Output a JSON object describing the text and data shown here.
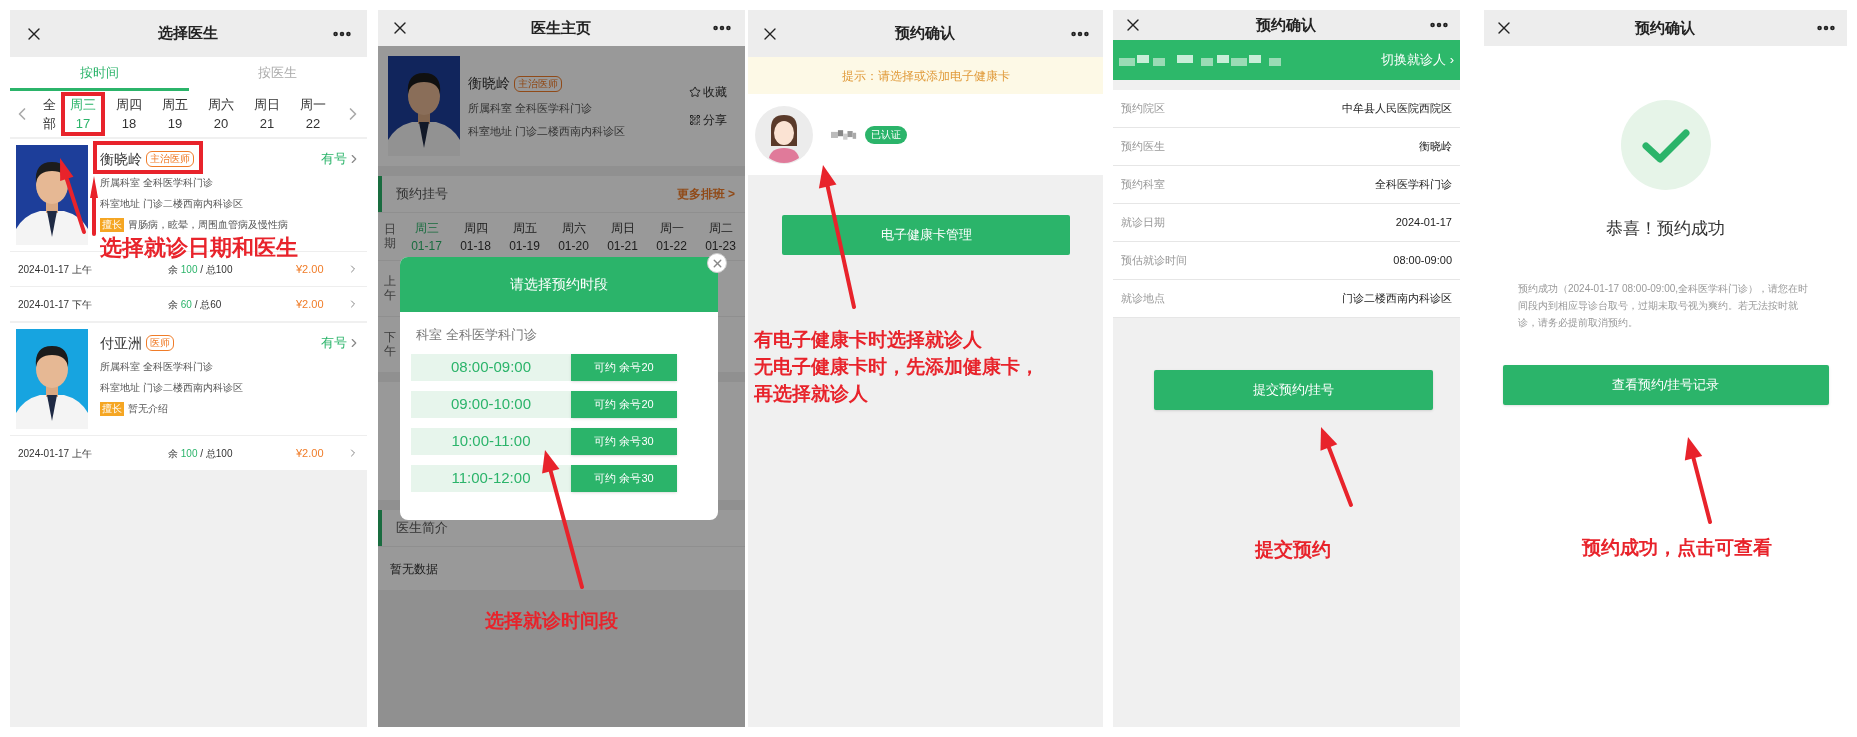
{
  "doctor_list_screen": {
    "title": "选择医生",
    "tabs": [
      {
        "label": "按时间",
        "selected": true
      },
      {
        "label": "按医生",
        "selected": false
      }
    ],
    "days": [
      {
        "weekday": "全",
        "date": "部",
        "selected": false
      },
      {
        "weekday": "周三",
        "date": "17",
        "selected": true
      },
      {
        "weekday": "周四",
        "date": "18",
        "selected": false
      },
      {
        "weekday": "周五",
        "date": "19",
        "selected": false
      },
      {
        "weekday": "周六",
        "date": "20",
        "selected": false
      },
      {
        "weekday": "周日",
        "date": "21",
        "selected": false
      },
      {
        "weekday": "周一",
        "date": "22",
        "selected": false
      }
    ],
    "doctors": [
      {
        "name": "衡晓岭",
        "title": "主治医师",
        "department_label": "所属科室",
        "department": "全科医学科门诊",
        "address_label": "科室地址",
        "address": "门诊二楼西南内科诊区",
        "specialty_label": "擅长",
        "specialty": "胃肠病，眩晕，周围血管病及慢性病",
        "availability": "有号",
        "schedules": [
          {
            "date": "2024-01-17",
            "period": "上午",
            "remain_label": "余",
            "remain": "100",
            "total": "/ 总100",
            "price": "¥2.00"
          },
          {
            "date": "2024-01-17",
            "period": "下午",
            "remain_label": "余",
            "remain": "60",
            "total": "/ 总60",
            "price": "¥2.00"
          }
        ]
      },
      {
        "name": "付亚洲",
        "title": "医师",
        "department_label": "所属科室",
        "department": "全科医学科门诊",
        "address_label": "科室地址",
        "address": "门诊二楼西南内科诊区",
        "specialty_label": "擅长",
        "specialty": "暂无介绍",
        "availability": "有号",
        "schedules": [
          {
            "date": "2024-01-17",
            "period": "上午",
            "remain_label": "余",
            "remain": "100",
            "total": "/ 总100",
            "price": "¥2.00"
          }
        ]
      }
    ],
    "annotation": "选择就诊日期和医生"
  },
  "doctor_home_screen": {
    "title": "医生主页",
    "doctor": {
      "name": "衡晓岭",
      "title": "主治医师",
      "department_label": "所属科室",
      "department": "全科医学科门诊",
      "address_label": "科室地址",
      "address": "门诊二楼西南内科诊区"
    },
    "actions": [
      "收藏",
      "分享"
    ],
    "section_title": "预约挂号",
    "more_link": "更多排班 >",
    "date_label": "日期",
    "dates": [
      {
        "weekday": "周三",
        "date": "01-17",
        "selected": true
      },
      {
        "weekday": "周四",
        "date": "01-18",
        "selected": false
      },
      {
        "weekday": "周五",
        "date": "01-19",
        "selected": false
      },
      {
        "weekday": "周六",
        "date": "01-20",
        "selected": false
      },
      {
        "weekday": "周日",
        "date": "01-21",
        "selected": false
      },
      {
        "weekday": "周一",
        "date": "01-22",
        "selected": false
      },
      {
        "weekday": "周二",
        "date": "01-23",
        "selected": false
      }
    ],
    "periods": [
      "上午",
      "下午"
    ],
    "intro_title": "医生简介",
    "intro_text": "暂无数据",
    "modal": {
      "title": "请选择预约时段",
      "department_label": "科室",
      "department": "全科医学科门诊",
      "slots": [
        {
          "time": "08:00-09:00",
          "button": "可约 余号20"
        },
        {
          "time": "09:00-10:00",
          "button": "可约 余号20"
        },
        {
          "time": "10:00-11:00",
          "button": "可约 余号30"
        },
        {
          "time": "11:00-12:00",
          "button": "可约 余号30"
        }
      ]
    },
    "annotation": "选择就诊时间段"
  },
  "patient_screen": {
    "title": "预约确认",
    "tip": "提示：请选择或添加电子健康卡",
    "verified_badge": "已认证",
    "button": "电子健康卡管理",
    "annotation_lines": [
      "有电子健康卡时选择就诊人",
      "无电子健康卡时，先添加健康卡，",
      "再选择就诊人"
    ]
  },
  "confirm_screen": {
    "title": "预约确认",
    "switch_link": "切换就诊人 ›",
    "details": [
      {
        "label": "预约院区",
        "value": "中牟县人民医院西院区"
      },
      {
        "label": "预约医生",
        "value": "衡晓岭"
      },
      {
        "label": "预约科室",
        "value": "全科医学科门诊"
      },
      {
        "label": "就诊日期",
        "value": "2024-01-17"
      },
      {
        "label": "预估就诊时间",
        "value": "08:00-09:00"
      },
      {
        "label": "就诊地点",
        "value": "门诊二楼西南内科诊区"
      }
    ],
    "submit_button": "提交预约/挂号",
    "annotation": "提交预约"
  },
  "success_screen": {
    "title": "预约确认",
    "success_title": "恭喜！预约成功",
    "message": "预约成功（2024-01-17 08:00-09:00,全科医学科门诊），请您在时间段内到相应导诊台取号，过期未取号视为爽约。若无法按时就诊，请务必提前取消预约。",
    "button": "查看预约/挂号记录",
    "annotation": "预约成功，点击可查看"
  }
}
